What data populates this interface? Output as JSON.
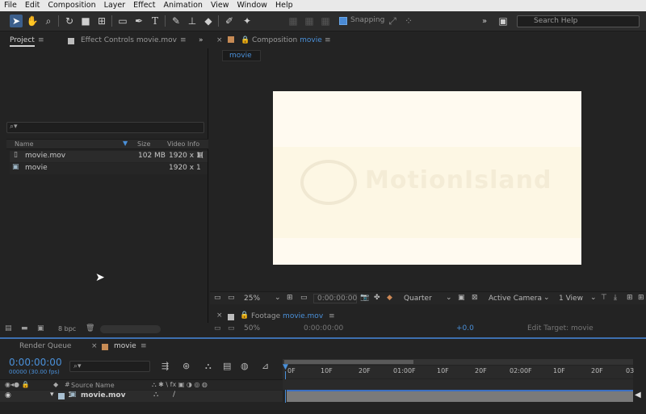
{
  "menu": [
    "File",
    "Edit",
    "Composition",
    "Layer",
    "Effect",
    "Animation",
    "View",
    "Window",
    "Help"
  ],
  "toolbar": {
    "snapping_label": "Snapping",
    "search_placeholder": "Search Help"
  },
  "project_panel": {
    "tab_project": "Project",
    "tab_effect_controls": "Effect Controls movie.mov",
    "columns": {
      "name": "Name",
      "size": "Size",
      "info": "Video Info"
    },
    "items": [
      {
        "name": "movie.mov",
        "size": "102 MB",
        "info": "1920 x 1("
      },
      {
        "name": "movie",
        "size": "",
        "info": "1920 x 1"
      }
    ],
    "bpc": "8 bpc"
  },
  "composition_panel": {
    "tab_prefix": "Composition",
    "tab_name": "movie",
    "sub_tab": "movie",
    "watermark": "MotionIsland",
    "controls": {
      "zoom": "25%",
      "timecode": "0:00:00:00",
      "resolution": "Quarter",
      "camera": "Active Camera",
      "views": "1 View"
    }
  },
  "footage_panel": {
    "tab_prefix": "Footage",
    "tab_name": "movie.mov",
    "zoom": "50%",
    "timecode": "0:00:00:00",
    "exposure": "+0.0",
    "edit_target": "Edit Target: movie"
  },
  "timeline": {
    "tab_render_queue": "Render Queue",
    "tab_movie": "movie",
    "timecode": "0:00:00:00",
    "frame_info": "00000 (30.00 fps)",
    "search_placeholder": "",
    "source_name_header": "Source Name",
    "layer_index": "1",
    "layer_name": "movie.mov",
    "ruler": [
      "0F",
      "10F",
      "20F",
      "01:00F",
      "10F",
      "20F",
      "02:00F",
      "10F",
      "20F",
      "03"
    ]
  },
  "colors": {
    "accent": "#4a90d9",
    "panel_bg": "#232323",
    "canvas": "#fffaf0"
  }
}
